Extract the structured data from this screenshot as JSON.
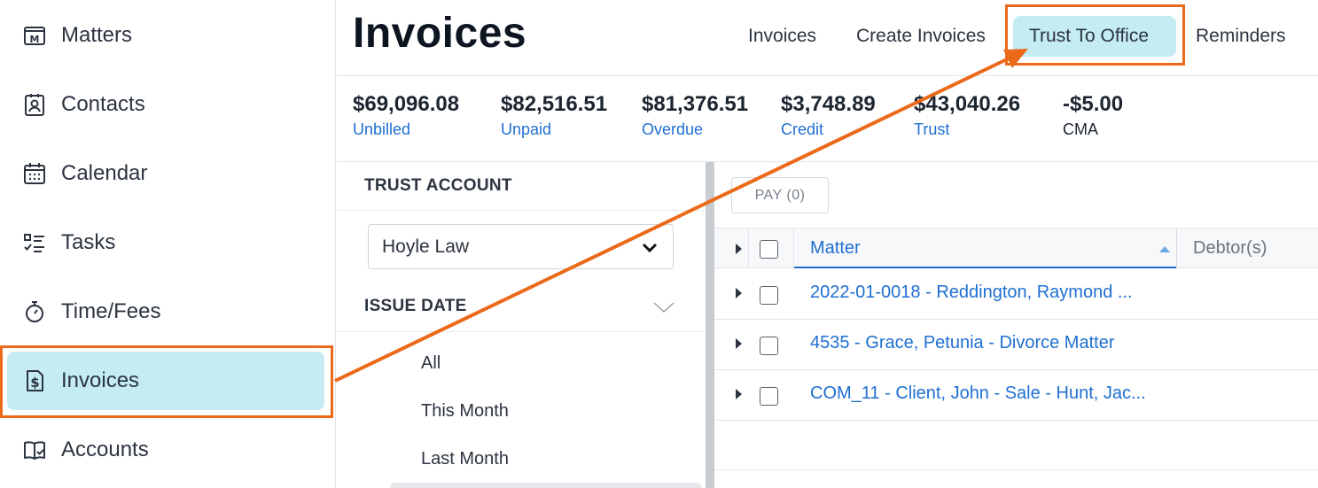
{
  "sidebar": {
    "items": [
      {
        "label": "Matters",
        "icon": "matters-icon"
      },
      {
        "label": "Contacts",
        "icon": "contacts-icon"
      },
      {
        "label": "Calendar",
        "icon": "calendar-icon"
      },
      {
        "label": "Tasks",
        "icon": "tasks-icon"
      },
      {
        "label": "Time/Fees",
        "icon": "stopwatch-icon"
      },
      {
        "label": "Invoices",
        "icon": "invoice-dollar-icon",
        "active": true
      },
      {
        "label": "Accounts",
        "icon": "book-check-icon"
      }
    ]
  },
  "header": {
    "title": "Invoices",
    "tabs": [
      {
        "label": "Invoices"
      },
      {
        "label": "Create Invoices"
      },
      {
        "label": "Trust To Office",
        "active": true
      },
      {
        "label": "Reminders"
      }
    ]
  },
  "stats": [
    {
      "amount": "$69,096.08",
      "label": "Unbilled"
    },
    {
      "amount": "$82,516.51",
      "label": "Unpaid"
    },
    {
      "amount": "$81,376.51",
      "label": "Overdue"
    },
    {
      "amount": "$3,748.89",
      "label": "Credit"
    },
    {
      "amount": "$43,040.26",
      "label": "Trust"
    },
    {
      "amount": "-$5.00",
      "label": "CMA"
    }
  ],
  "filters": {
    "trust_account_title": "TRUST ACCOUNT",
    "trust_account_value": "Hoyle Law",
    "issue_date_title": "ISSUE DATE",
    "issue_date_options": [
      "All",
      "This Month",
      "Last Month"
    ]
  },
  "table": {
    "pay_button": "PAY (0)",
    "columns": {
      "matter": "Matter",
      "debtors": "Debtor(s)"
    },
    "rows": [
      {
        "matter": "2022-01-0018 - Reddington, Raymond ..."
      },
      {
        "matter": "4535 - Grace, Petunia - Divorce Matter"
      },
      {
        "matter": "COM_11 - Client, John - Sale - Hunt, Jac..."
      }
    ]
  },
  "colors": {
    "accent_bg": "#c4ecf2",
    "highlight": "#ea6a1a",
    "link": "#1f6fd1"
  }
}
